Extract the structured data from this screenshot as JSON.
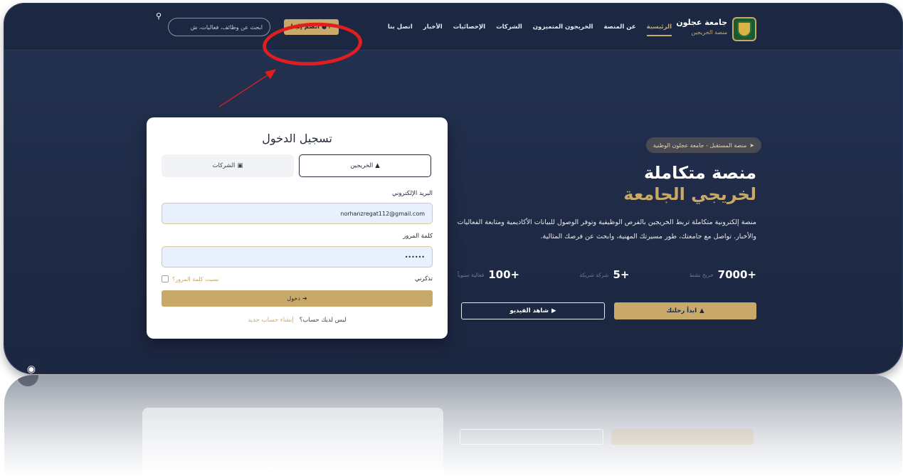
{
  "brand": {
    "title": "جامعة عجلون",
    "subtitle": "منصة الخريجين"
  },
  "nav": {
    "items": [
      {
        "label": "الرئيسية"
      },
      {
        "label": "عن المنصة"
      },
      {
        "label": "الخريجون المتميزون"
      },
      {
        "label": "الشركات"
      },
      {
        "label": "الإحصائيات"
      },
      {
        "label": "الأخبار"
      },
      {
        "label": "اتصل بنا"
      }
    ],
    "join_label": "انضم إلينا",
    "search_placeholder": "ابحث عن وظائف، فعاليات، ش"
  },
  "hero": {
    "badge": "منصة المستقبل - جامعة عجلون الوطنية",
    "title_line1": "منصة متكاملة",
    "title_line2": "لخريجي الجامعة",
    "description": "منصة إلكترونية متكاملة تربط الخريجين بالفرص الوظيفية وتوفر الوصول للبيانات الأكاديمية ومتابعة الفعاليات والأخبار. تواصل مع جامعتك، طور مسيرتك المهنية، وابحث عن فرصك المثالية.",
    "stats": [
      {
        "value": "7000+",
        "label": "خريج نشط"
      },
      {
        "value": "5+",
        "label": "شركة شريكة"
      },
      {
        "value": "100+",
        "label": "فعالية سنوياً"
      }
    ],
    "start_label": "ابدأ رحلتك",
    "video_label": "شاهد الفيديو"
  },
  "login": {
    "title": "تسجيل الدخول",
    "tab_graduates": "الخريجين",
    "tab_companies": "الشركات",
    "email_label": "البريد الإلكتروني",
    "email_value": "norhanzregat112@gmail.com",
    "password_label": "كلمة المرور",
    "password_value": "••••••",
    "remember_label": "تذكرني",
    "forgot_label": "نسيت كلمة المرور؟",
    "submit_label": "دخول",
    "no_account": "ليس لديك حساب؟",
    "signup_label": "إنشاء حساب جديد"
  },
  "colors": {
    "navy": "#1c2742",
    "gold": "#c8a96a",
    "annotation": "#e01e1e"
  }
}
